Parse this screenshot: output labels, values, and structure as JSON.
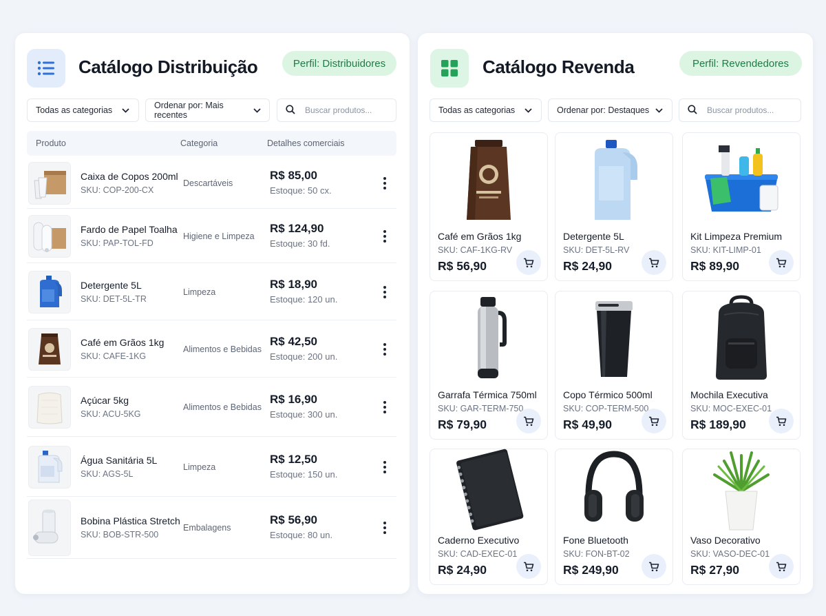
{
  "distribution": {
    "title": "Catálogo Distribuição",
    "icon": "list-icon",
    "badge": "Perfil: Distribuidores",
    "filters": {
      "category": "Todas as categorias",
      "sort": "Ordenar por: Mais recentes",
      "search_placeholder": "Buscar produtos..."
    },
    "columns": {
      "product": "Produto",
      "category": "Categoria",
      "details": "Detalhes comerciais"
    },
    "rows": [
      {
        "name": "Caixa de Copos 200ml",
        "sku": "SKU: COP-200-CX",
        "category": "Descartáveis",
        "price": "R$ 85,00",
        "stock": "Estoque: 50 cx."
      },
      {
        "name": "Fardo de Papel Toalha",
        "sku": "SKU: PAP-TOL-FD",
        "category": "Higiene e Limpeza",
        "price": "R$ 124,90",
        "stock": "Estoque: 30 fd."
      },
      {
        "name": "Detergente 5L",
        "sku": "SKU: DET-5L-TR",
        "category": "Limpeza",
        "price": "R$ 18,90",
        "stock": "Estoque: 120 un."
      },
      {
        "name": "Café em Grãos 1kg",
        "sku": "SKU: CAFE-1KG",
        "category": "Alimentos e Bebidas",
        "price": "R$ 42,50",
        "stock": "Estoque: 200 un."
      },
      {
        "name": "Açúcar 5kg",
        "sku": "SKU: ACU-5KG",
        "category": "Alimentos e Bebidas",
        "price": "R$ 16,90",
        "stock": "Estoque: 300 un."
      },
      {
        "name": "Água Sanitária 5L",
        "sku": "SKU: AGS-5L",
        "category": "Limpeza",
        "price": "R$ 12,50",
        "stock": "Estoque: 150 un."
      },
      {
        "name": "Bobina Plástica Stretch",
        "sku": "SKU: BOB-STR-500",
        "category": "Embalagens",
        "price": "R$ 56,90",
        "stock": "Estoque: 80 un."
      }
    ]
  },
  "resale": {
    "title": "Catálogo Revenda",
    "icon": "grid-icon",
    "badge": "Perfil: Revendedores",
    "filters": {
      "category": "Todas as categorias",
      "sort": "Ordenar por: Destaques",
      "search_placeholder": "Buscar produtos..."
    },
    "products": [
      {
        "name": "Café em Grãos 1kg",
        "sku": "SKU: CAF-1KG-RV",
        "price": "R$ 56,90",
        "image": "coffee-bag-image"
      },
      {
        "name": "Detergente 5L",
        "sku": "SKU: DET-5L-RV",
        "price": "R$ 24,90",
        "image": "detergent-jug-image"
      },
      {
        "name": "Kit Limpeza Premium",
        "sku": "SKU: KIT-LIMP-01",
        "price": "R$ 89,90",
        "image": "cleaning-kit-image"
      },
      {
        "name": "Garrafa Térmica 750ml",
        "sku": "SKU: GAR-TERM-750",
        "price": "R$ 79,90",
        "image": "thermal-bottle-image"
      },
      {
        "name": "Copo Térmico 500ml",
        "sku": "SKU: COP-TERM-500",
        "price": "R$ 49,90",
        "image": "thermal-cup-image"
      },
      {
        "name": "Mochila Executiva",
        "sku": "SKU: MOC-EXEC-01",
        "price": "R$ 189,90",
        "image": "backpack-image"
      },
      {
        "name": "Caderno Executivo",
        "sku": "SKU: CAD-EXEC-01",
        "price": "R$ 24,90",
        "image": "notebook-image"
      },
      {
        "name": "Fone Bluetooth",
        "sku": "SKU: FON-BT-02",
        "price": "R$ 249,90",
        "image": "headphones-image"
      },
      {
        "name": "Vaso Decorativo",
        "sku": "SKU: VASO-DEC-01",
        "price": "R$ 27,90",
        "image": "plant-vase-image"
      }
    ]
  },
  "colors": {
    "accent_blue": "#2f6fd6",
    "accent_green": "#25a25a",
    "badge_bg": "#dcf5e3",
    "badge_text": "#1f7a45"
  }
}
